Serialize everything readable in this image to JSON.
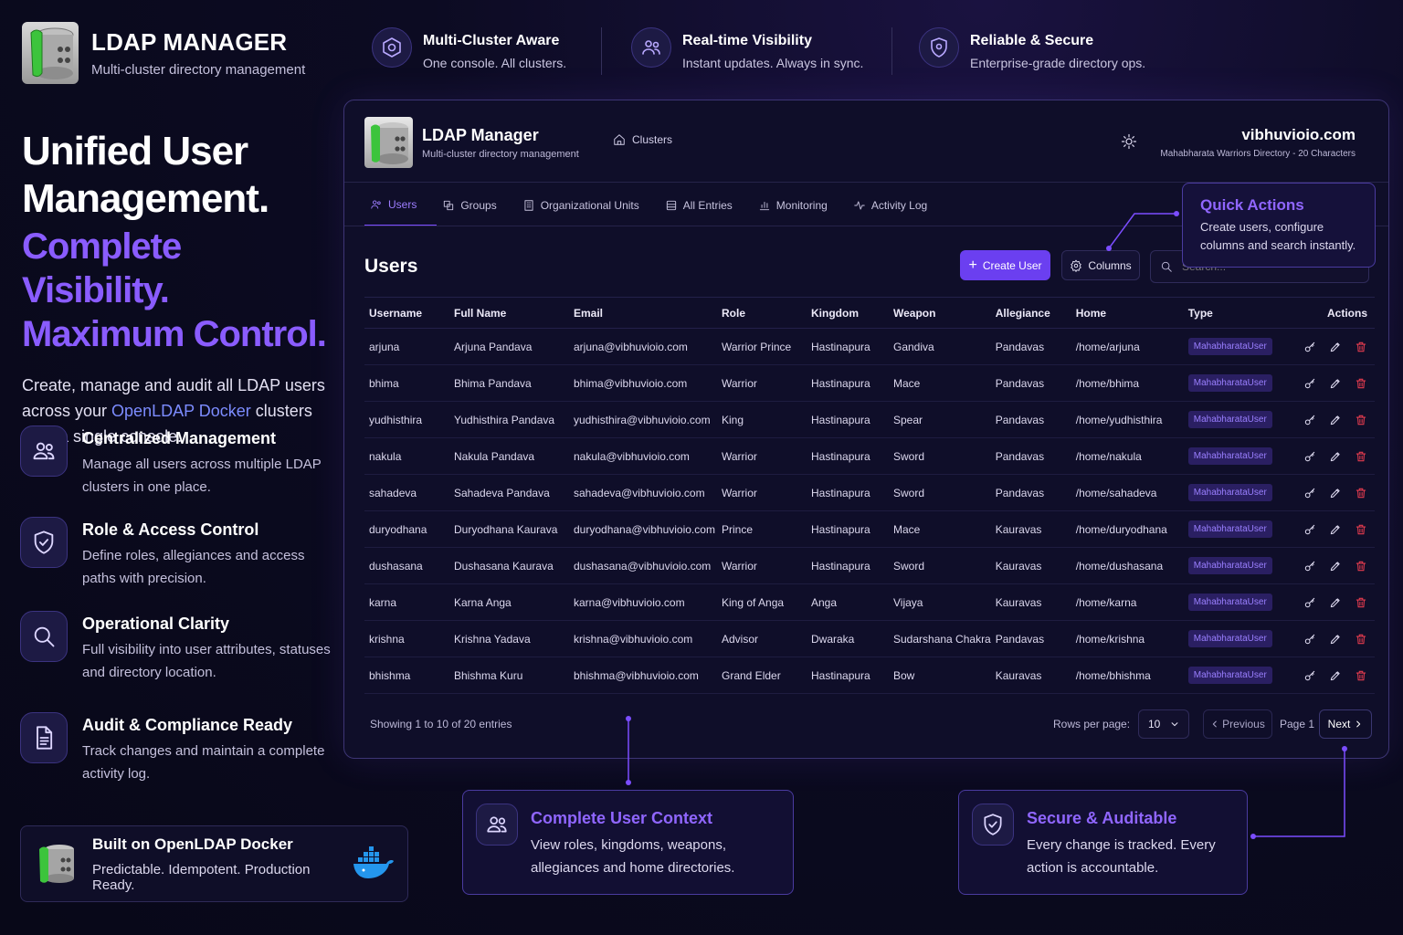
{
  "brand": {
    "title": "LDAP MANAGER",
    "subtitle": "Multi-cluster directory management"
  },
  "top_features": [
    {
      "icon": "cluster-icon",
      "title": "Multi-Cluster Aware",
      "text": "One console. All clusters."
    },
    {
      "icon": "users-sync-icon",
      "title": "Real-time Visibility",
      "text": "Instant updates. Always in sync."
    },
    {
      "icon": "shield-icon",
      "title": "Reliable & Secure",
      "text": "Enterprise-grade directory ops."
    }
  ],
  "hero": {
    "line1": "Unified User",
    "line2": "Management.",
    "line3": "Complete Visibility.",
    "line4": "Maximum Control.",
    "desc_pre": "Create, manage and audit all LDAP users across your ",
    "desc_link": "OpenLDAP Docker",
    "desc_post": " clusters from a single console."
  },
  "left_features": [
    {
      "icon": "users-icon",
      "title": "Centralized Management",
      "text": "Manage all users across multiple LDAP clusters in one place."
    },
    {
      "icon": "shield-check-icon",
      "title": "Role & Access Control",
      "text": "Define roles, allegiances and access paths with precision."
    },
    {
      "icon": "search-icon",
      "title": "Operational Clarity",
      "text": "Full visibility into user attributes, statuses and directory location."
    },
    {
      "icon": "document-icon",
      "title": "Audit & Compliance Ready",
      "text": "Track changes and maintain a complete activity log."
    }
  ],
  "built_on": {
    "title": "Built on OpenLDAP Docker",
    "text": "Predictable. Idempotent. Production Ready."
  },
  "app": {
    "title": "LDAP Manager",
    "subtitle": "Multi-cluster directory management",
    "nav_clusters": "Clusters",
    "domain": "vibhuvioio.com",
    "domain_sub": "Mahabharata Warriors Directory - 20 Characters",
    "tabs": [
      "Users",
      "Groups",
      "Organizational Units",
      "All Entries",
      "Monitoring",
      "Activity Log"
    ],
    "heading": "Users",
    "create_label": "Create User",
    "columns_label": "Columns",
    "search_placeholder": "Search...",
    "columns": [
      "Username",
      "Full Name",
      "Email",
      "Role",
      "Kingdom",
      "Weapon",
      "Allegiance",
      "Home",
      "Type",
      "Actions"
    ],
    "rows": [
      [
        "arjuna",
        "Arjuna Pandava",
        "arjuna@vibhuvioio.com",
        "Warrior Prince",
        "Hastinapura",
        "Gandiva",
        "Pandavas",
        "/home/arjuna",
        "MahabharataUser"
      ],
      [
        "bhima",
        "Bhima Pandava",
        "bhima@vibhuvioio.com",
        "Warrior",
        "Hastinapura",
        "Mace",
        "Pandavas",
        "/home/bhima",
        "MahabharataUser"
      ],
      [
        "yudhisthira",
        "Yudhisthira Pandava",
        "yudhisthira@vibhuvioio.com",
        "King",
        "Hastinapura",
        "Spear",
        "Pandavas",
        "/home/yudhisthira",
        "MahabharataUser"
      ],
      [
        "nakula",
        "Nakula Pandava",
        "nakula@vibhuvioio.com",
        "Warrior",
        "Hastinapura",
        "Sword",
        "Pandavas",
        "/home/nakula",
        "MahabharataUser"
      ],
      [
        "sahadeva",
        "Sahadeva Pandava",
        "sahadeva@vibhuvioio.com",
        "Warrior",
        "Hastinapura",
        "Sword",
        "Pandavas",
        "/home/sahadeva",
        "MahabharataUser"
      ],
      [
        "duryodhana",
        "Duryodhana Kaurava",
        "duryodhana@vibhuvioio.com",
        "Prince",
        "Hastinapura",
        "Mace",
        "Kauravas",
        "/home/duryodhana",
        "MahabharataUser"
      ],
      [
        "dushasana",
        "Dushasana Kaurava",
        "dushasana@vibhuvioio.com",
        "Warrior",
        "Hastinapura",
        "Sword",
        "Kauravas",
        "/home/dushasana",
        "MahabharataUser"
      ],
      [
        "karna",
        "Karna Anga",
        "karna@vibhuvioio.com",
        "King of Anga",
        "Anga",
        "Vijaya",
        "Kauravas",
        "/home/karna",
        "MahabharataUser"
      ],
      [
        "krishna",
        "Krishna Yadava",
        "krishna@vibhuvioio.com",
        "Advisor",
        "Dwaraka",
        "Sudarshana Chakra",
        "Pandavas",
        "/home/krishna",
        "MahabharataUser"
      ],
      [
        "bhishma",
        "Bhishma Kuru",
        "bhishma@vibhuvioio.com",
        "Grand Elder",
        "Hastinapura",
        "Bow",
        "Kauravas",
        "/home/bhishma",
        "MahabharataUser"
      ]
    ],
    "showing": "Showing 1 to 10 of 20 entries",
    "rows_per_page_label": "Rows per page:",
    "rows_per_page": "10",
    "previous": "Previous",
    "page": "Page 1",
    "next": "Next"
  },
  "callouts": {
    "quick": {
      "title": "Quick Actions",
      "text": "Create users, configure columns and search instantly."
    },
    "context": {
      "title": "Complete User Context",
      "text": "View roles, kingdoms, weapons, allegiances and home directories."
    },
    "secure": {
      "title": "Secure & Auditable",
      "text": "Every change is tracked. Every action is accountable."
    }
  },
  "colors": {
    "accent": "#7b4dff",
    "background": "#0c0b22",
    "danger": "#e23b4e"
  }
}
